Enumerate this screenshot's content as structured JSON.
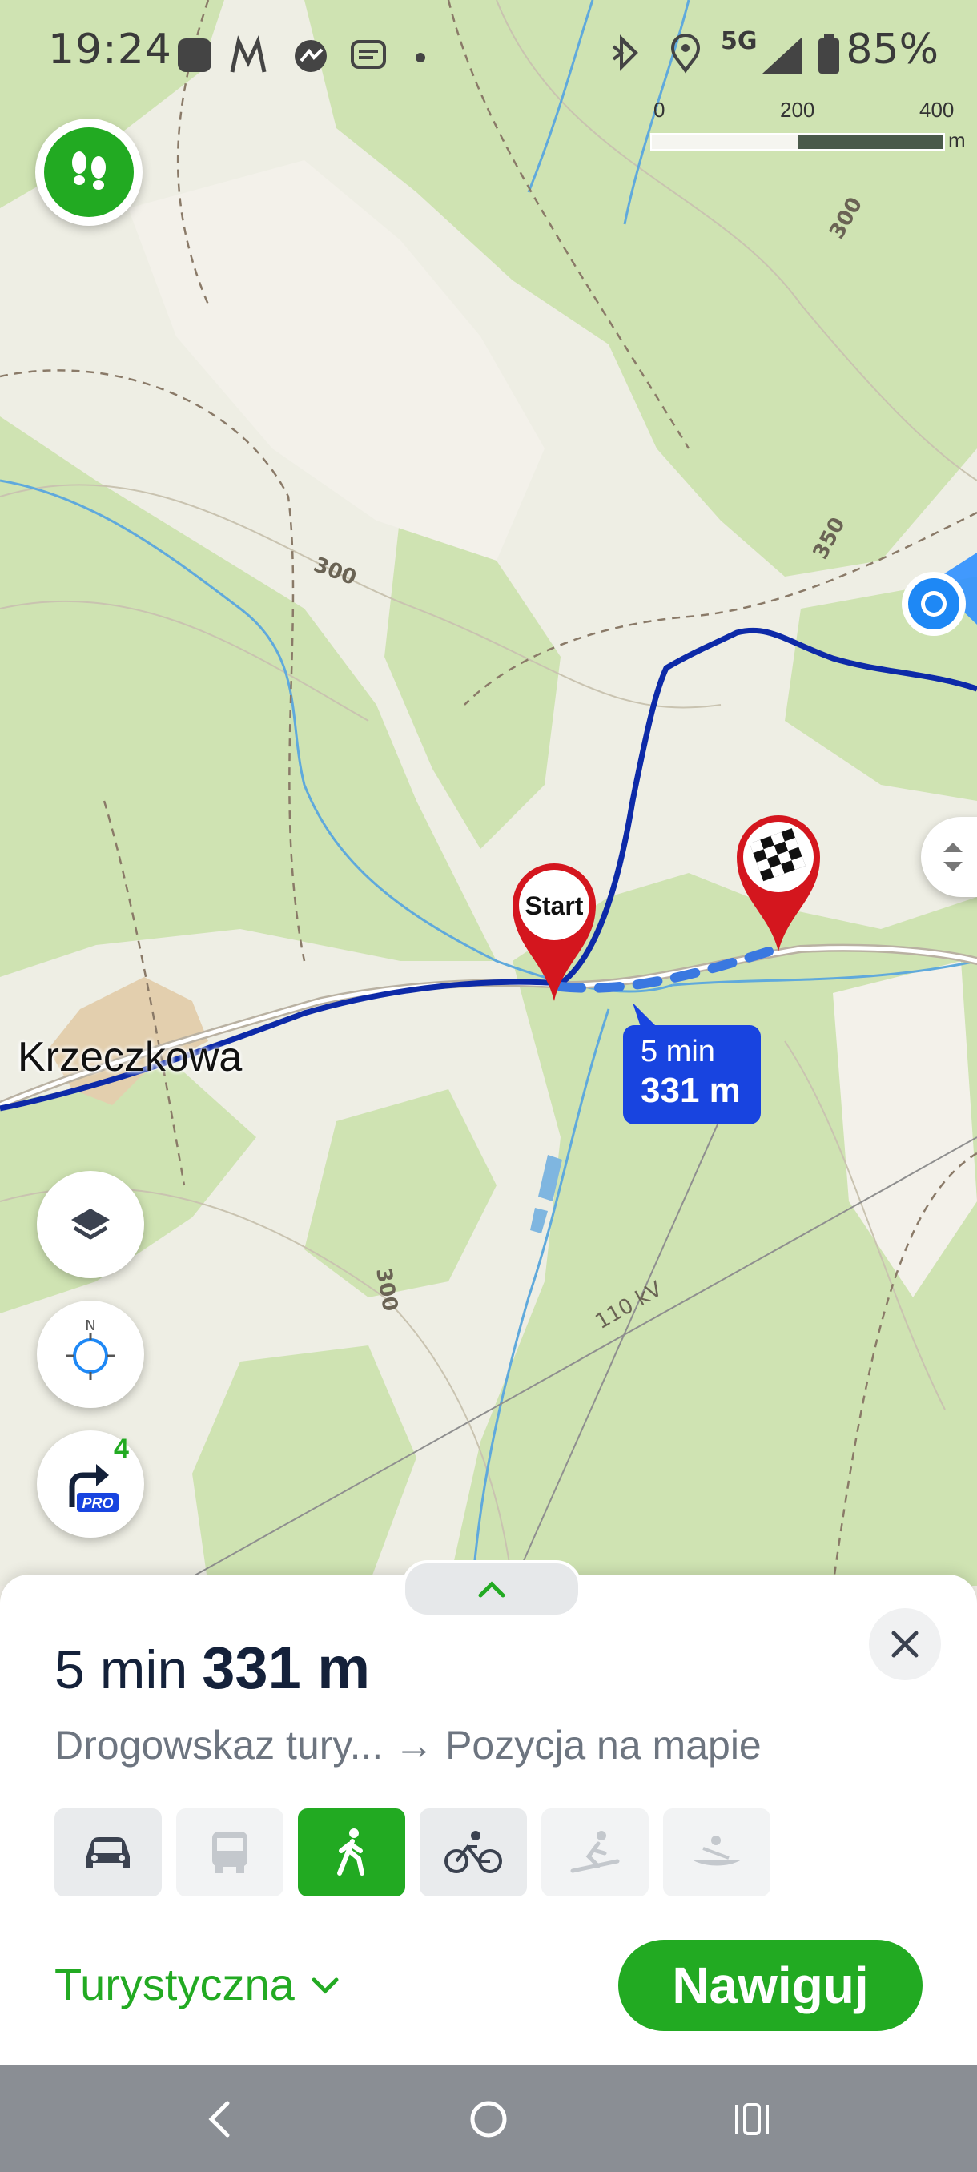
{
  "status_bar": {
    "time": "19:24",
    "network": "5G",
    "battery": "85%"
  },
  "scale_bar": {
    "labels": [
      "0",
      "200",
      "400"
    ],
    "unit": "m"
  },
  "map": {
    "town_label": "Krzeczkowa",
    "start_label": "Start",
    "contour_labels": [
      "300",
      "300",
      "350",
      "300"
    ],
    "powerline_label": "110 kV",
    "route_bubble": {
      "time": "5 min",
      "distance": "331 m"
    }
  },
  "map_controls": {
    "compass_letter": "N",
    "pro_label": "PRO",
    "pro_badge": "4"
  },
  "sheet": {
    "time": "5 min",
    "distance": "331 m",
    "route_text": "Drogowskaz tury... → Pozycja na mapie",
    "transport_modes": [
      {
        "name": "car",
        "state": "enabled"
      },
      {
        "name": "bus",
        "state": "disabled"
      },
      {
        "name": "walk",
        "state": "selected"
      },
      {
        "name": "bike",
        "state": "enabled"
      },
      {
        "name": "ski",
        "state": "disabled"
      },
      {
        "name": "boat",
        "state": "disabled"
      }
    ],
    "profile_label": "Turystyczna",
    "navigate_label": "Nawiguj"
  },
  "colors": {
    "brand_green": "#22aa22",
    "route_blue": "#0d2aa8",
    "bubble_blue": "#1844e0",
    "marker_red": "#d4161e"
  }
}
